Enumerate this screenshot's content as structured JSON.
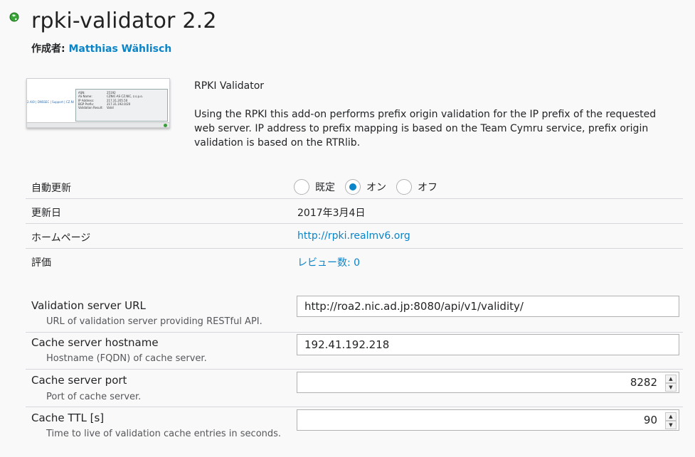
{
  "header": {
    "title": "rpki-validator 2.2",
    "author_label": "作成者:",
    "author_name": "Matthias Wählisch"
  },
  "thumbnail": {
    "links": "2.AIO | DNSSEC | Support | CZ.NI",
    "rows": [
      {
        "k": "ASN:",
        "v": "25192"
      },
      {
        "k": "AS Name:",
        "v": "CZNIC-AS CZ.NIC, z.s.p.o."
      },
      {
        "k": "IP Address:",
        "v": "217.31.205.50"
      },
      {
        "k": "BGP Prefix:",
        "v": "217.31.192.0/20"
      },
      {
        "k": "Validation Result:",
        "v": "Valid"
      }
    ]
  },
  "description": {
    "name": "RPKI Validator",
    "body": "Using the RPKI this add-on performs prefix origin validation for the IP prefix of the requested web server. IP address to prefix mapping is based on the Team Cymru service, prefix origin validation is based on the RTRlib."
  },
  "details": {
    "auto_update": {
      "label": "自動更新",
      "options": [
        {
          "label": "既定",
          "selected": false
        },
        {
          "label": "オン",
          "selected": true
        },
        {
          "label": "オフ",
          "selected": false
        }
      ]
    },
    "updated": {
      "label": "更新日",
      "value": "2017年3月4日"
    },
    "homepage": {
      "label": "ホームページ",
      "value": "http://rpki.realmv6.org"
    },
    "rating": {
      "label": "評価",
      "value": "レビュー数: 0"
    }
  },
  "prefs": {
    "validation_url": {
      "label": "Validation server URL",
      "desc": "URL of validation server providing RESTful API.",
      "value": "http://roa2.nic.ad.jp:8080/api/v1/validity/"
    },
    "cache_host": {
      "label": "Cache server hostname",
      "desc": "Hostname (FQDN) of cache server.",
      "value": "192.41.192.218"
    },
    "cache_port": {
      "label": "Cache server port",
      "desc": "Port of cache server.",
      "value": "8282"
    },
    "cache_ttl": {
      "label": "Cache TTL [s]",
      "desc": "Time to live of validation cache entries in seconds.",
      "value": "90"
    }
  },
  "colors": {
    "accent": "#0a84c8",
    "background": "#f9f9fa"
  }
}
